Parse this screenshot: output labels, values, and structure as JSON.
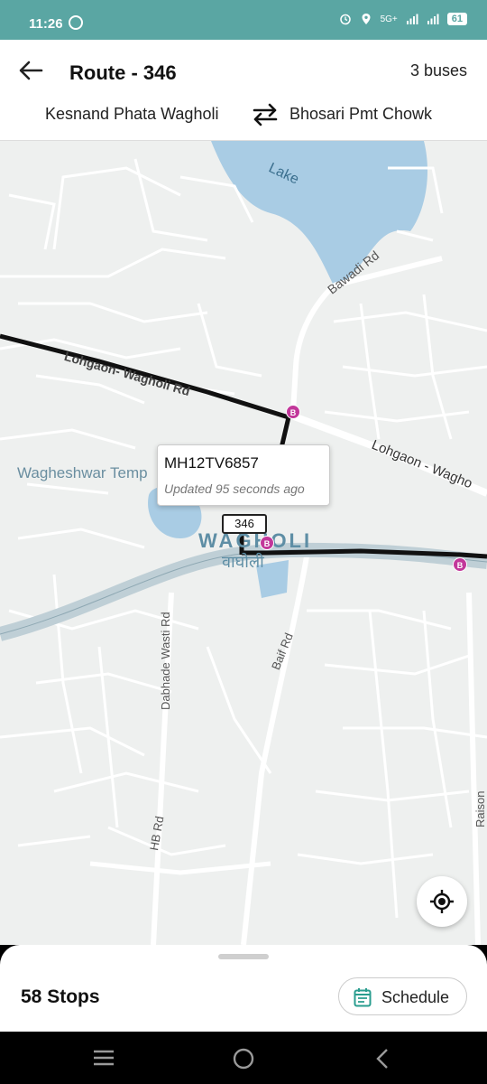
{
  "status_bar": {
    "time": "11:26",
    "network": "5G+",
    "battery": "61"
  },
  "header": {
    "route_title": "Route - 346",
    "bus_count": "3 buses",
    "from_stop": "Kesnand Phata Wagholi",
    "to_stop": "Bhosari Pmt Chowk"
  },
  "map": {
    "lake_label": "Lake",
    "roads": {
      "bawadi": "Bawadi Rd",
      "lohgaon_wagholi": "Lohgaon- Wagholi Rd",
      "lohgaon_wagho": "Lohgaon - Wagho",
      "dabhade": "Dabhade Wasti Rd",
      "baif": "Baif Rd",
      "hb": "HB Rd",
      "raison": "Raison"
    },
    "place_temple": "Wagheshwar Temp",
    "place_main": "WAGHOLI",
    "place_main_local": "वाघोली",
    "bus_popup": {
      "plate": "MH12TV6857",
      "updated": "Updated 95 seconds ago"
    },
    "bus_marker_label": "346",
    "stop_pin_label": "B",
    "route_color": "#111111",
    "stop_color": "#c2379a"
  },
  "bottom_sheet": {
    "stops": "58 Stops",
    "schedule_label": "Schedule"
  },
  "colors": {
    "status_bar": "#5aa6a3",
    "accent": "#2a9d8f"
  }
}
